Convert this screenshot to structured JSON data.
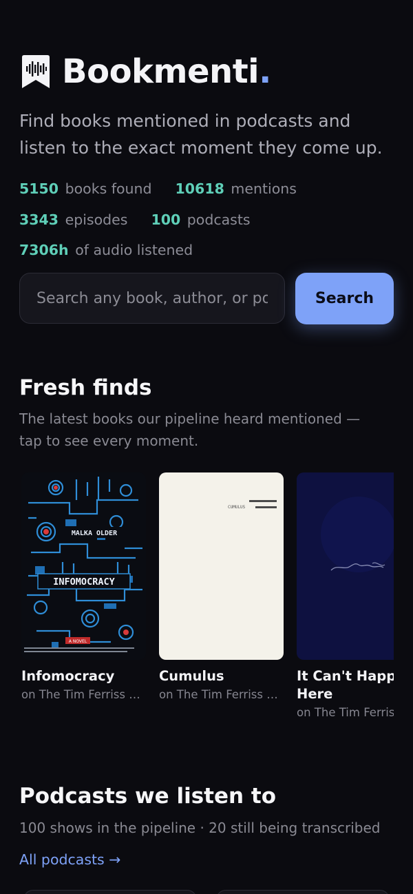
{
  "brand": {
    "name": "Bookmenti",
    "dot": ".",
    "icon": "bookmark-waveform-icon"
  },
  "tagline": "Find books mentioned in podcasts and listen to the exact moment they come up.",
  "stats": {
    "books": {
      "value": "5150",
      "label": "books found"
    },
    "mentions": {
      "value": "10618",
      "label": "mentions"
    },
    "episodes": {
      "value": "3343",
      "label": "episodes"
    },
    "podcasts": {
      "value": "100",
      "label": "podcasts"
    },
    "audio": {
      "value": "7306h",
      "label": "of audio listened"
    }
  },
  "search": {
    "placeholder": "Search any book, author, or podcast",
    "button": "Search"
  },
  "fresh": {
    "title": "Fresh finds",
    "subtitle_line1": "The latest books our pipeline heard mentioned —",
    "subtitle_line2": "tap to see every moment.",
    "books": [
      {
        "title": "Infomocracy",
        "source": "on The Tim Ferriss Show",
        "cover_author": "MALKA OLDER",
        "cover_title": "INFOMOCRACY",
        "cover_tag": "A NOVEL"
      },
      {
        "title": "Cumulus",
        "source": "on The Tim Ferriss Show",
        "cover_title": "CUMULUS"
      },
      {
        "title_line1": "It Can't Happen",
        "title_line2": "Here",
        "source": "on The Tim Ferriss Show"
      }
    ]
  },
  "podcasts": {
    "title": "Podcasts we listen to",
    "subtitle": "100 shows in the pipeline · 20 still being transcribed",
    "link": "All podcasts →"
  },
  "colors": {
    "background": "#0b0b10",
    "accent": "#7ea2f8",
    "stat_number": "#5fcfb8"
  }
}
